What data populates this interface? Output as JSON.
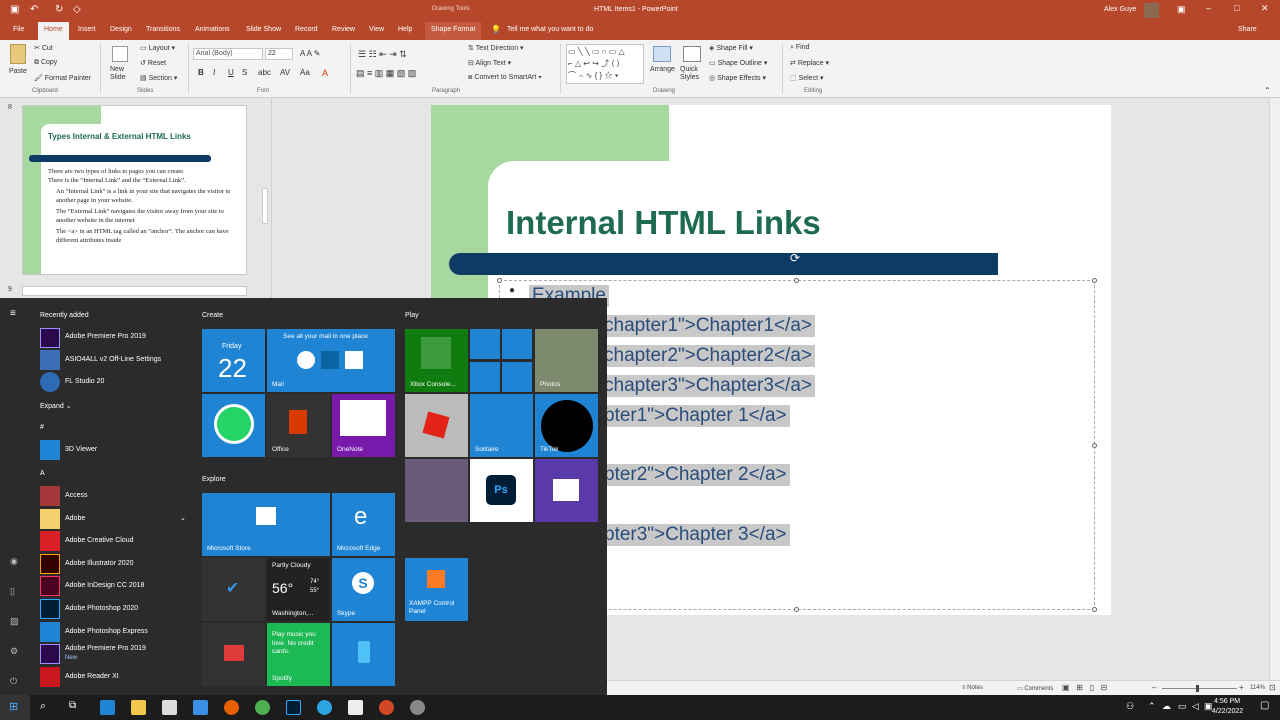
{
  "window": {
    "title": "HTML Items1 - PowerPoint",
    "context_label": "Drawing Tools",
    "user": "Alex Guye",
    "share": "Share"
  },
  "ribbon_tabs": [
    "File",
    "Home",
    "Insert",
    "Design",
    "Transitions",
    "Animations",
    "Slide Show",
    "Record",
    "Review",
    "View",
    "Help",
    "Shape Format"
  ],
  "tell_me": "Tell me what you want to do",
  "ribbon": {
    "clipboard": {
      "paste": "Paste",
      "cut": "Cut",
      "copy": "Copy",
      "format_painter": "Format Painter",
      "group": "Clipboard"
    },
    "slides": {
      "new_slide": "New Slide",
      "layout": "Layout",
      "reset": "Reset",
      "section": "Section",
      "group": "Slides"
    },
    "font": {
      "name": "Arial (Body)",
      "size": "22",
      "group": "Font"
    },
    "paragraph": {
      "text_direction": "Text Direction",
      "align_text": "Align Text",
      "convert": "Convert to SmartArt",
      "group": "Paragraph"
    },
    "drawing": {
      "arrange": "Arrange",
      "quick_styles": "Quick Styles",
      "shape_fill": "Shape Fill",
      "shape_outline": "Shape Outline",
      "shape_effects": "Shape Effects",
      "group": "Drawing"
    },
    "editing": {
      "find": "Find",
      "replace": "Replace",
      "select": "Select",
      "group": "Editing"
    }
  },
  "thumbnails": {
    "slide8_num": "8",
    "slide9_num": "9",
    "slide8_title": "Types Internal & External HTML Links",
    "slide8_intro_1": "There are two types of links to pages you can create.",
    "slide8_intro_2": "There is the “Internal Link” and the “External Link”.",
    "slide8_b1": "An “Internal Link” is a link in your site that navigates the visitor to another page in your website.",
    "slide8_b2": "The “External Link” navigates the visitor away from your site to another website in the internet",
    "slide8_b3": "The <a> in an HTML tag called an “anchor”. The anchor can have different attributes inside"
  },
  "slide": {
    "title": "Internal HTML Links",
    "bullet": "Example",
    "lines": [
      "chapter1\">Chapter1</a>",
      "chapter2\">Chapter2</a>",
      "chapter3\">Chapter3</a>",
      "pter1\">Chapter 1</a>",
      "pter2\">Chapter 2</a>",
      "pter3\">Chapter 3</a>"
    ]
  },
  "status": {
    "notes": "Notes",
    "comments": "Comments",
    "zoom": "114%"
  },
  "start_menu": {
    "recently_added": "Recently added",
    "recent": [
      "Adobe Premiere Pro 2019",
      "ASIO4ALL v2 Off-Line Settings",
      "FL Studio 20"
    ],
    "expand": "Expand",
    "hash": "#",
    "viewer": "3D Viewer",
    "letter_a": "A",
    "apps": [
      "Access",
      "Adobe",
      "Adobe Creative Cloud",
      "Adobe Illustrator 2020",
      "Adobe InDesign CC 2018",
      "Adobe Photoshop 2020",
      "Adobe Photoshop Express",
      "Adobe Premiere Pro 2019",
      "Adobe Reader XI"
    ],
    "new_badge": "New",
    "sections": {
      "create": "Create",
      "play": "Play",
      "explore": "Explore"
    },
    "tiles": {
      "calendar_day": "Friday",
      "calendar_date": "22",
      "mail_promo": "See all your mail in one place",
      "mail": "Mail",
      "office": "Office",
      "onenote": "OneNote",
      "xbox": "Xbox Console...",
      "photos": "Photos",
      "solitaire": "Solitaire",
      "tiktok": "TikTok",
      "store": "Microsoft Store",
      "edge": "Microsoft Edge",
      "weather_cond": "Partly Cloudy",
      "weather_temp": "56°",
      "weather_hi": "74°",
      "weather_lo": "55°",
      "weather_city": "Washington,...",
      "skype": "Skype",
      "xampp": "XAMPP Control Panel",
      "spotify_promo": "Play music you love. No credit cards.",
      "spotify": "Spotify",
      "ps": "Ps"
    }
  },
  "taskbar": {
    "time": "4:56 PM",
    "date": "4/22/2022"
  },
  "colors": {
    "accent": "#b7472a",
    "slide_title": "#1e6b52",
    "slide_bar": "#0d3b66",
    "tile_blue": "#1f84d4",
    "slide_green": "#a6d8a0"
  }
}
